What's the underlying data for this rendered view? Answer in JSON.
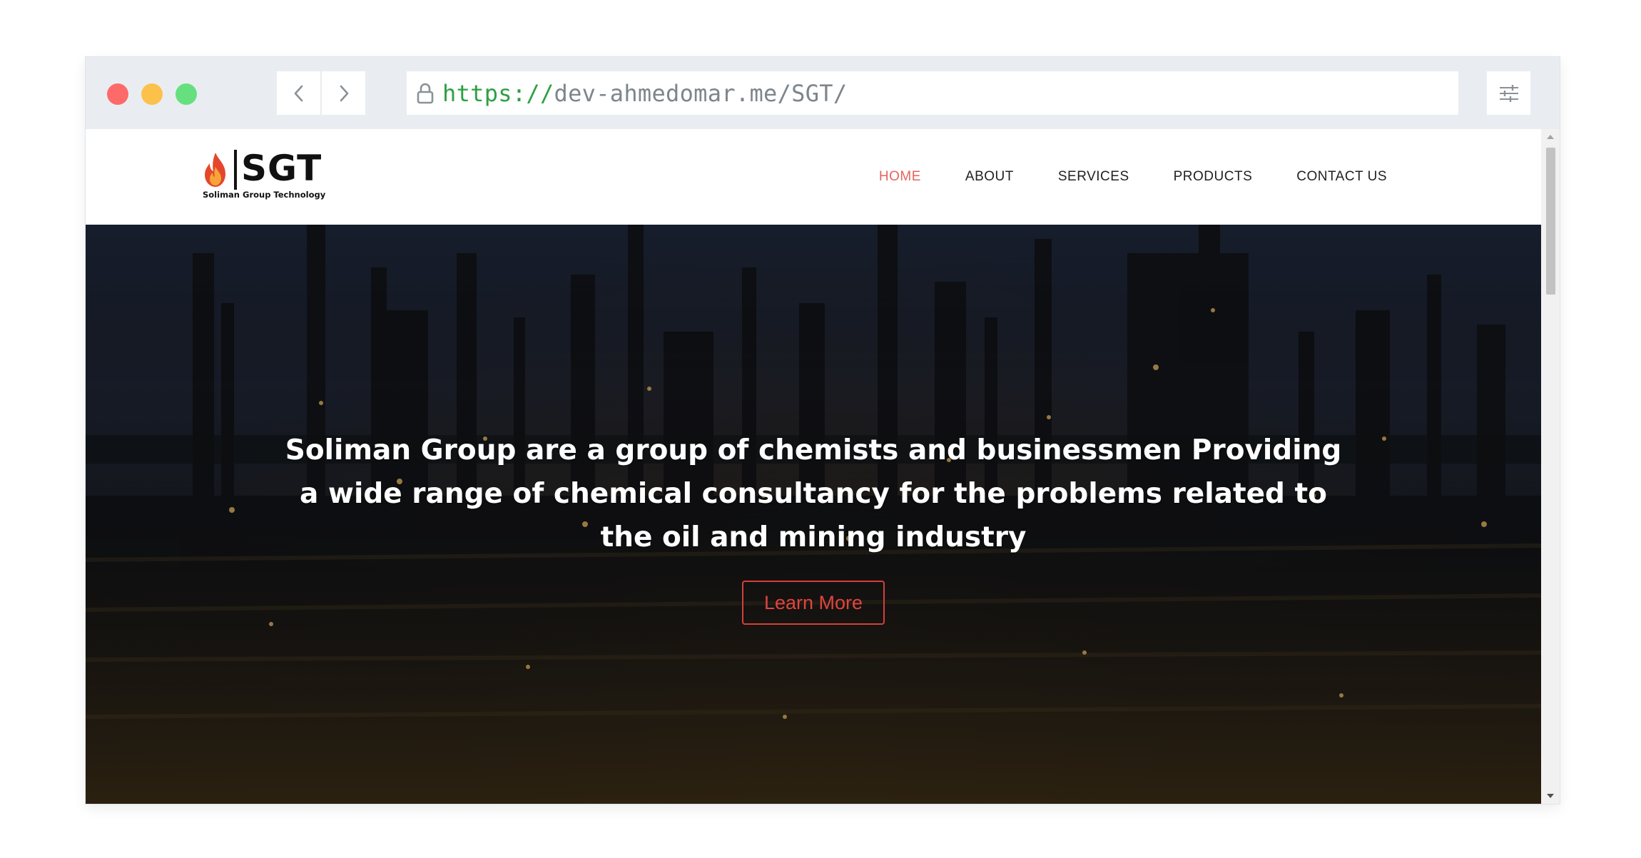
{
  "browser": {
    "traffic_lights": [
      {
        "name": "close",
        "color": "#fe6a6a"
      },
      {
        "name": "minimize",
        "color": "#fcc14b"
      },
      {
        "name": "maximize",
        "color": "#66e07f"
      }
    ],
    "back_icon": "chevron-left-icon",
    "forward_icon": "chevron-right-icon",
    "url_scheme": "https://",
    "url_host": "dev-ahmedomar.me/SGT/",
    "lock_icon": "lock-icon",
    "menu_icon": "sliders-icon"
  },
  "site": {
    "logo": {
      "text": "SGT",
      "tagline": "Soliman Group Technology",
      "flame_colors": [
        "#e4472b",
        "#f7a43a"
      ]
    },
    "nav": [
      {
        "label": "HOME",
        "active": true
      },
      {
        "label": "ABOUT",
        "active": false
      },
      {
        "label": "SERVICES",
        "active": false
      },
      {
        "label": "PRODUCTS",
        "active": false
      },
      {
        "label": "CONTACT US",
        "active": false
      }
    ],
    "hero": {
      "headline": "Soliman Group are a group of chemists and businessmen Providing a wide range of chemical consultancy for the problems related to the oil and mining industry",
      "cta_label": "Learn More"
    }
  },
  "colors": {
    "accent": "#e4655e",
    "cta_border": "#d3403b",
    "scheme_green": "#2ea043"
  }
}
